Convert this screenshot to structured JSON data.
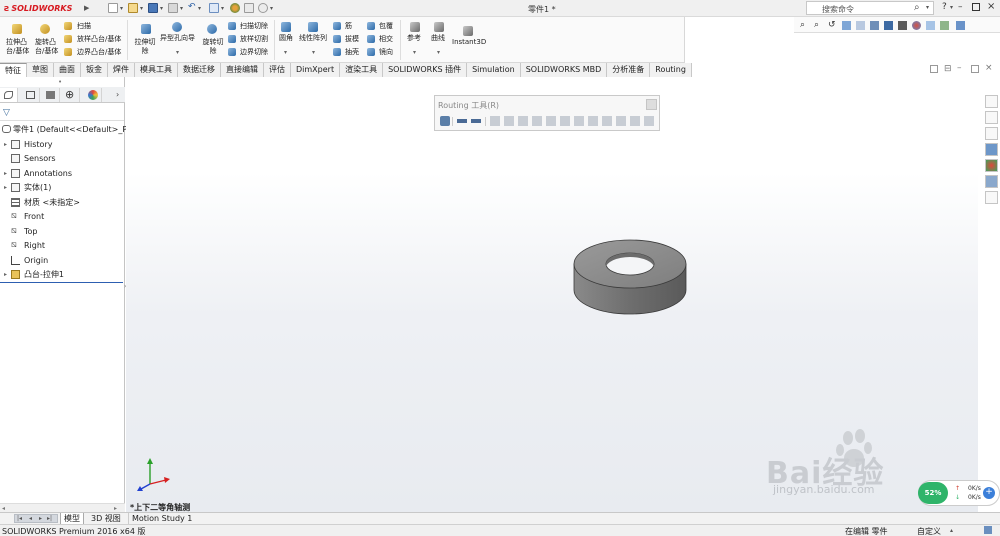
{
  "app": {
    "brand": "SOLIDWORKS",
    "document_title": "零件1 *",
    "search_placeholder": "搜索命令"
  },
  "command_manager": {
    "extrude_boss": "拉伸凸台/基体",
    "revolve_boss": "旋转凸台/基体",
    "sweep": "扫描",
    "loft_boss": "放样凸台/基体",
    "boundary_boss": "边界凸台/基体",
    "extrude_cut": "拉伸切除",
    "hole_wizard": "异型孔向导",
    "revolve_cut": "旋转切除",
    "swept_cut": "扫描切除",
    "lofted_cut": "放样切割",
    "boundary_cut": "边界切除",
    "fillet": "圆角",
    "linear_pattern": "线性阵列",
    "rib": "筋",
    "draft": "拔模",
    "shell": "抽壳",
    "wrap": "包覆",
    "intersect": "相交",
    "mirror": "镜向",
    "reference": "参考",
    "curves": "曲线",
    "instant3d": "Instant3D"
  },
  "tabs": [
    "特征",
    "草图",
    "曲面",
    "钣金",
    "焊件",
    "模具工具",
    "数据迁移",
    "直接编辑",
    "评估",
    "DimXpert",
    "渲染工具",
    "SOLIDWORKS 插件",
    "Simulation",
    "SOLIDWORKS MBD",
    "分析准备",
    "Routing"
  ],
  "feature_tree": {
    "root": "零件1  (Default<<Default>_Ph",
    "items": [
      {
        "label": "History",
        "expandable": true,
        "icon": "history-icon"
      },
      {
        "label": "Sensors",
        "expandable": false,
        "icon": "sensor-icon"
      },
      {
        "label": "Annotations",
        "expandable": true,
        "icon": "annotation-icon"
      },
      {
        "label": "实体(1)",
        "expandable": true,
        "icon": "solid-body-icon"
      },
      {
        "label": "材质 <未指定>",
        "expandable": false,
        "icon": "material-icon"
      },
      {
        "label": "Front",
        "expandable": false,
        "icon": "plane-icon"
      },
      {
        "label": "Top",
        "expandable": false,
        "icon": "plane-icon"
      },
      {
        "label": "Right",
        "expandable": false,
        "icon": "plane-icon"
      },
      {
        "label": "Origin",
        "expandable": false,
        "icon": "origin-icon"
      },
      {
        "label": "凸台-拉伸1",
        "expandable": true,
        "icon": "extrude-feature-icon"
      }
    ]
  },
  "routing_toolbar": {
    "title": "Routing 工具(R)"
  },
  "viewport": {
    "view_name": "*上下二等角轴测"
  },
  "bottom_tabs": [
    "模型",
    "3D 视图",
    "Motion Study 1"
  ],
  "status": {
    "product": "SOLIDWORKS Premium 2016 x64 版",
    "mode": "在编辑 零件",
    "units": "自定义"
  },
  "network_widget": {
    "percent": "52%",
    "upload": "0K/s",
    "download": "0K/s"
  },
  "watermark": {
    "text": "Bai经验",
    "url": "jingyan.baidu.com"
  },
  "colors": {
    "brand_red": "#d71920",
    "selection_blue": "#2d5fb1",
    "part_gray": "#7a7a7a",
    "net_green": "#2fb46a"
  }
}
